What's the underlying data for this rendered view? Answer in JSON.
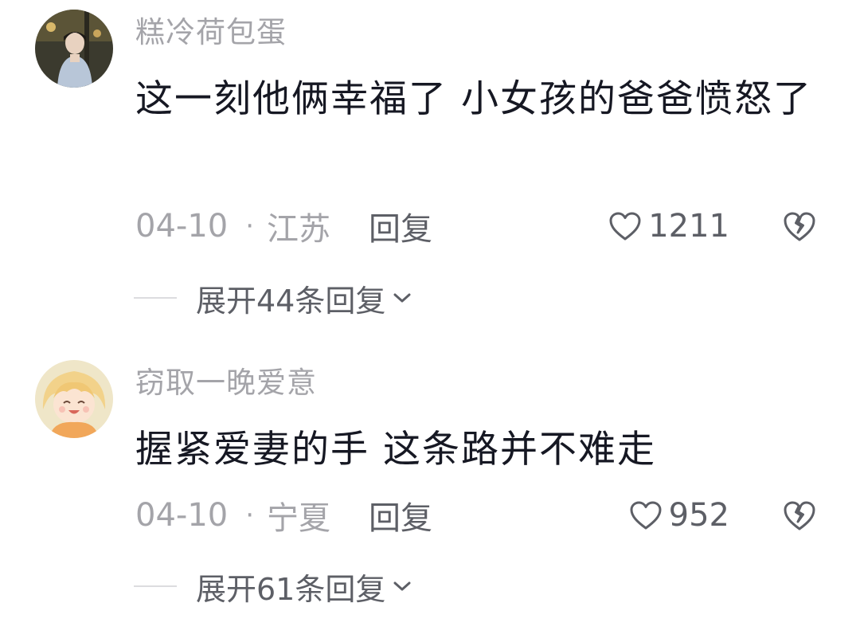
{
  "comments": [
    {
      "username": "糕冷荷包蛋",
      "text": "这一刻他俩幸福了 小女孩的爸爸愤怒了",
      "date": "04-10",
      "location": "江苏",
      "reply_label": "回复",
      "likes": "1211",
      "expand_label": "展开44条回复"
    },
    {
      "username": "窃取一晚爱意",
      "text": "握紧爱妻的手 这条路并不难走",
      "date": "04-10",
      "location": "宁夏",
      "reply_label": "回复",
      "likes": "952",
      "expand_label": "展开61条回复"
    }
  ],
  "separator": "·",
  "icons": {
    "like": "heart-outline-icon",
    "dislike": "broken-heart-icon",
    "expand": "chevron-down-icon"
  },
  "colors": {
    "text_primary": "#161823",
    "text_secondary": "#a4a4a9",
    "text_action": "#5d5f66"
  }
}
